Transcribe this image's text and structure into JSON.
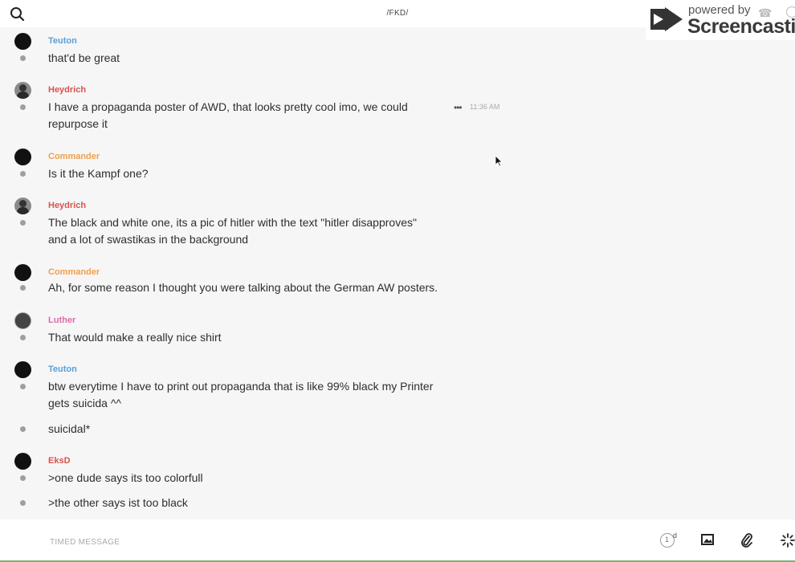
{
  "header": {
    "channel_name": "/FKD/",
    "search_icon": "search-icon"
  },
  "watermark": {
    "powered_by": "powered by",
    "brand": "Screencastify",
    "icons": [
      "play-icon",
      "phone-icon",
      "info-icon"
    ]
  },
  "messages": [
    {
      "author": "Teuton",
      "author_color": "#5aa0d8",
      "text": "that'd be great"
    },
    {
      "author": "Heydrich",
      "author_color": "#d9534f",
      "text": "I have a propaganda poster of AWD, that looks pretty cool imo, we could repurpose it",
      "actions_icon": "more-icon",
      "time": "11:36 AM"
    },
    {
      "author": "Commander",
      "author_color": "#f0a04b",
      "text": "Is it the Kampf one?"
    },
    {
      "author": "Heydrich",
      "author_color": "#d9534f",
      "text": "The black and white one, its a pic of hitler with the text \"hitler disapproves\" and a lot of swastikas in the background"
    },
    {
      "author": "Commander",
      "author_color": "#f0a04b",
      "text": "Ah, for some reason I thought you were talking about the German AW posters."
    },
    {
      "author": "Luther",
      "author_color": "#e06aa8",
      "text": "That would make a really nice shirt"
    },
    {
      "author": "Teuton",
      "author_color": "#5aa0d8",
      "text": "btw everytime I have to print out propaganda that is like 99% black my Printer gets suicida ^^"
    },
    {
      "author": "",
      "text": "suicidal*"
    },
    {
      "author": "EksD",
      "author_color": "#d9534f",
      "text": ">one dude says its too colorfull"
    },
    {
      "author": "",
      "text": ">the other says ist too black"
    }
  ],
  "composer": {
    "placeholder": "TIMED MESSAGE",
    "timer_value": "1",
    "timer_unit": "d",
    "icons": [
      "timer-icon",
      "image-icon",
      "paperclip-icon",
      "sparkle-icon"
    ]
  }
}
